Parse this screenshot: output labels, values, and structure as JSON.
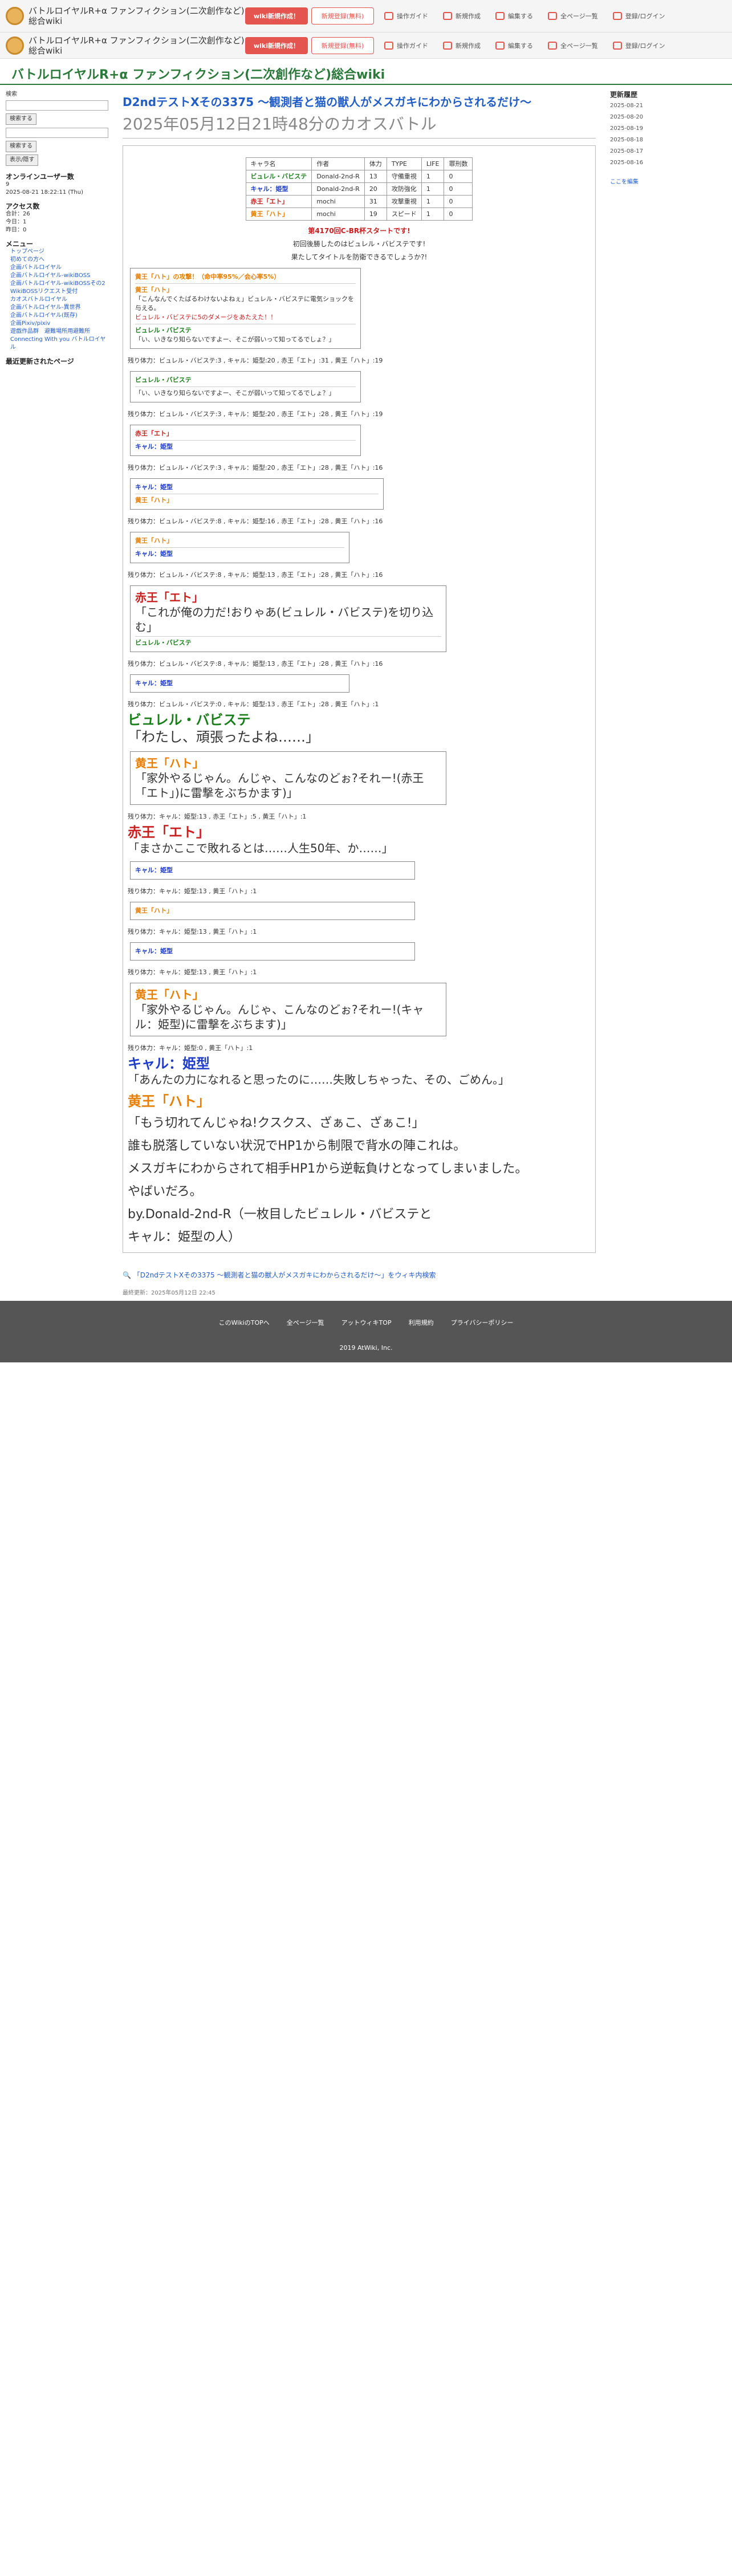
{
  "header": {
    "site": "バトルロイヤルR+α ファンフィクション(二次創作など)総合wiki",
    "btn_new": "wiki新規作成！",
    "btn_login": "新規登録(無料)",
    "nav": [
      "操作ガイド",
      "新規作成",
      "編集する",
      "全ページ一覧",
      "登録/ログイン"
    ]
  },
  "wiki_title": "バトルロイヤルR+α ファンフィクション(二次創作など)総合wiki",
  "left": {
    "search_label": "検索",
    "search_btn": "検索する",
    "online_btn": "表示/隠す",
    "online": "オンラインユーザー数",
    "online_num": "9",
    "time": "2025-08-21 18:22:11 (Thu)",
    "access": "アクセス数",
    "access_total": "合計：26",
    "today": "今日：1",
    "yesterday": "昨日：0",
    "menu": "メニュー",
    "menu_items": [
      "トップページ",
      "初めての方へ",
      "企画バトルロイヤル",
      "企画バトルロイヤル-wikiBOSS",
      "企画バトルロイヤル-wikiBOSSその2",
      "WikiBOSSリクエスト受付",
      "カオスバトルロイヤル",
      "企画バトルロイヤル-異世界",
      "企画バトルロイヤル(既存)",
      "企画Pixiv/pixiv",
      "遊戯作品群　避難場所用避難所",
      "Connecting With you バトルロイヤル"
    ],
    "recent": "最近更新されたページ"
  },
  "page": {
    "title": "D2ndテストXその3375 〜観測者と猫の獣人がメスガキにわからされるだけ〜",
    "subtitle": "2025年05月12日21時48分のカオスバトル"
  },
  "status": {
    "headers": [
      "キャラ名",
      "作者",
      "体力",
      "TYPE",
      "LIFE",
      "罪刑数"
    ],
    "rows": [
      [
        "ビュレル・バビステ",
        "Donald-2nd-R",
        "13",
        "守備重視",
        "1",
        "0"
      ],
      [
        "キャル：姫型",
        "Donald-2nd-R",
        "20",
        "攻防強化",
        "1",
        "0"
      ],
      [
        "赤王「エト」",
        "mochi",
        "31",
        "攻撃重視",
        "1",
        "0"
      ],
      [
        "黄王「ハト」",
        "mochi",
        "19",
        "スピード",
        "1",
        "0"
      ]
    ]
  },
  "intro": [
    "第4170回C-BR杯スタートです!",
    "初回後勝したのはビュレル・バビステです!",
    "果たしてタイトルを防衛できるでしょうか?!"
  ],
  "remains": [
    "残り体力：ビュレル・バビステ:3 , キャル：姫型:20 , 赤王「エト」:31 , 黄王「ハト」:19",
    "残り体力：ビュレル・バビステ:3 , キャル：姫型:20 , 赤王「エト」:28 , 黄王「ハト」:19",
    "残り体力：ビュレル・バビステ:3 , キャル：姫型:20 , 赤王「エト」:28 , 黄王「ハト」:16",
    "残り体力：ビュレル・バビステ:8 , キャル：姫型:16 , 赤王「エト」:28 , 黄王「ハト」:16",
    "残り体力：ビュレル・バビステ:8 , キャル：姫型:13 , 赤王「エト」:28 , 黄王「ハト」:16",
    "残り体力：ビュレル・バビステ:8 , キャル：姫型:13 , 赤王「エト」:28 , 黄王「ハト」:16",
    "残り体力：ビュレル・バビステ:0 , キャル：姫型:13 , 赤王「エト」:28 , 黄王「ハト」:1",
    "残り体力：キャル：姫型:13 , 赤王「エト」:5 , 黄王「ハト」:1",
    "残り体力：キャル：姫型:13 , 黄王「ハト」:1",
    "残り体力：キャル：姫型:13 , 黄王「ハト」:1",
    "残り体力：キャル：姫型:13 , 黄王「ハト」:1",
    "残り体力：キャル：姫型:0 , 黄王「ハト」:1"
  ],
  "lines": {
    "l1": "黄王「ハト」の攻撃！（命中率95%／会心率5%）",
    "l2": "黄王「ハト」",
    "l3": "「こんなんでくたばるわけないよねぇ」ビュレル・バビステに電気ショックを与える。",
    "l4": "ビュレル・バビステに5のダメージをあたえた！！",
    "l5": "ビュレル・バビステ",
    "l6": "「い、いきなり知らないですよー、そこが弱いって知ってるでしょ？」",
    "big1": "「これが俺の力だ!おりゃあ(ビュレル・バビステ)を切り込む」",
    "big2": "「家外やるじゃん。んじゃ、こんなのどぉ?それー!(赤王「エト」)に雷撃をぶちかます)」",
    "big3": "「まさかここで敗れるとは……人生50年、か……」",
    "big4": "「家外やるじゃん。んじゃ、こんなのどぉ?それー!(キャル：姫型)に雷撃をぶちます)」",
    "big5": "「あんたの力になれると思ったのに……失敗しちゃった、その、ごめん。」",
    "defeat1": "ビュレル・バビステ",
    "defeat1_quote": "「わたし、頑張ったよね……」",
    "defeat2": "赤王「エト」",
    "defeat3": "キャル：姫型",
    "winner": "黄王「ハト」",
    "finale1": "「もう切れてんじゃね!クスクス、ざぁこ、ざぁこ!」",
    "finale2": "誰も脱落していない状況でHP1から制限で背水の陣これは。",
    "finale3": "メスガキにわからされて相手HP1から逆転負けとなってしまいました。",
    "finale4": "やばいだろ。",
    "finale5a": "by.Donald-2nd-R（一枚目したビュレル・バビステと",
    "finale5b": "キャル：姫型の人）"
  },
  "search_link": "「D2ndテストXその3375 〜観測者と猫の獣人がメスガキにわからされるだけ〜」をウィキ内検索",
  "lastmod": "最終更新：2025年05月12日 22:45",
  "right": {
    "title": "更新履歴",
    "dates": [
      "2025-08-21",
      "2025-08-20",
      "2025-08-19",
      "2025-08-18",
      "2025-08-17",
      "2025-08-16"
    ],
    "edit": "ここを編集"
  },
  "footer": {
    "links": [
      "このWikiのTOPへ",
      "全ページ一覧",
      "アットウィキTOP",
      "利用規約",
      "プライバシーポリシー"
    ],
    "copy": "2019 AtWiki, Inc."
  }
}
